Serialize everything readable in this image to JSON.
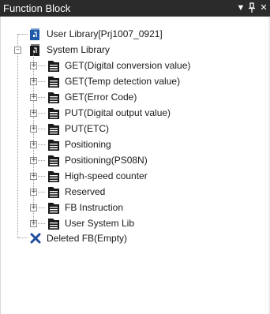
{
  "panel": {
    "title": "Function Block",
    "dropdown_icon": "chevron-down-icon",
    "pin_icon": "pin-icon",
    "close_icon": "close-icon"
  },
  "tree": {
    "user_library": {
      "label": "User Library[Prj1007_0921]",
      "icon": "user-library-icon"
    },
    "system_library": {
      "label": "System Library",
      "icon": "system-library-icon",
      "expanded": true,
      "children": [
        "GET(Digital conversion value)",
        "GET(Temp detection value)",
        "GET(Error Code)",
        "PUT(Digital output value)",
        "PUT(ETC)",
        "Positioning",
        "Positioning(PS08N)",
        "High-speed counter",
        "Reserved",
        "FB Instruction",
        "User System Lib"
      ]
    },
    "deleted": {
      "label": "Deleted FB(Empty)",
      "icon": "delete-x-icon"
    }
  },
  "colors": {
    "titlebar": "#2b2b2b",
    "user_lib_icon": "#1f5aa8",
    "system_lib_icon": "#1a1a1a",
    "delete_icon": "#1f4f9c"
  }
}
